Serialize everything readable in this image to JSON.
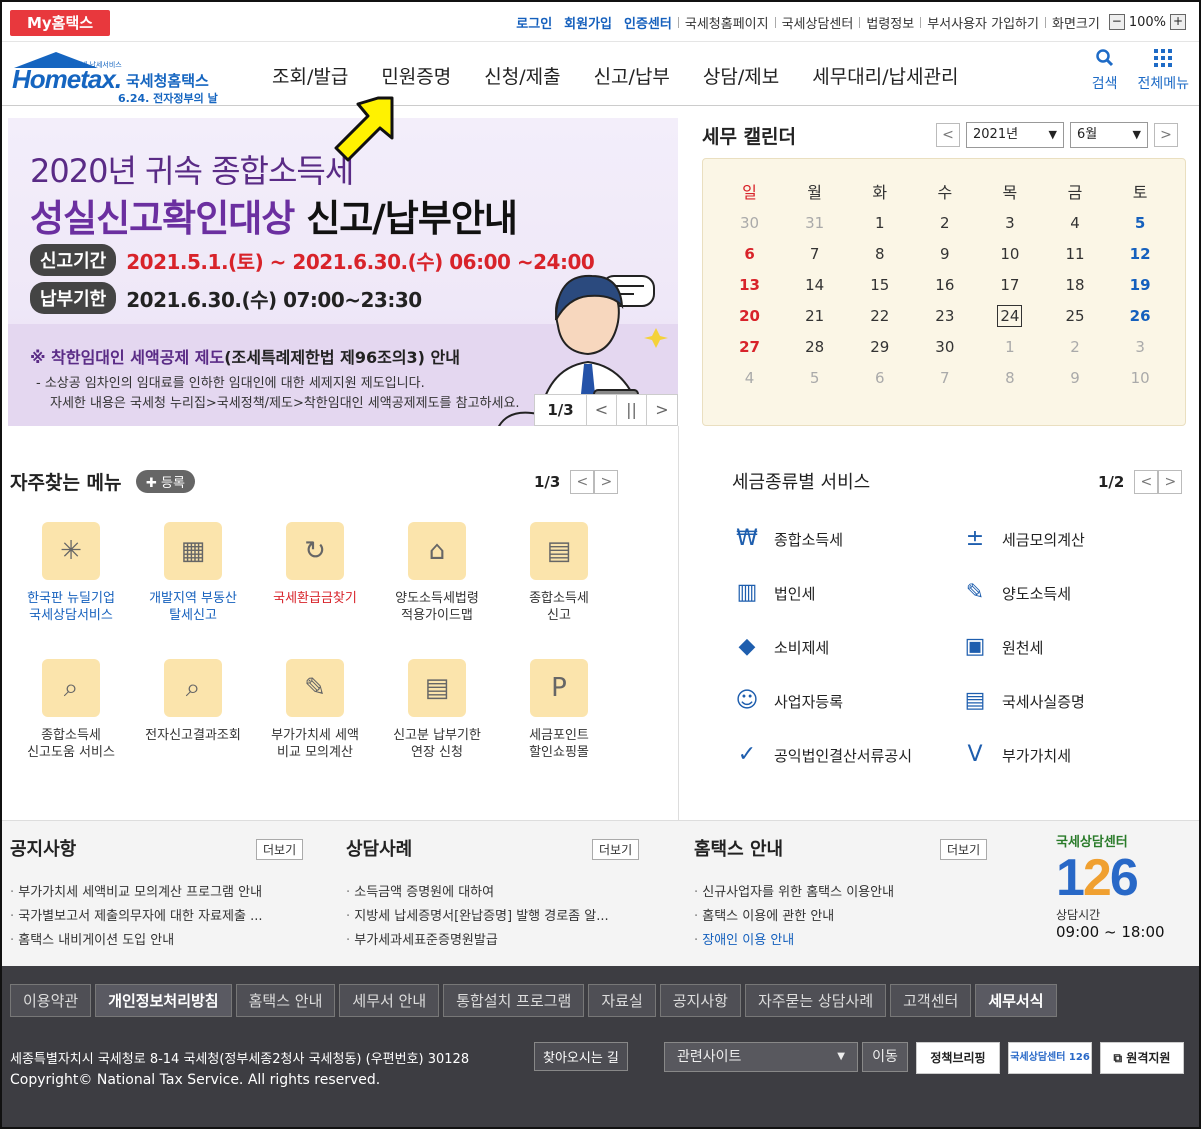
{
  "topbar": {
    "myhome": "My홈택스",
    "links_blue": [
      "로그인",
      "회원가입",
      "인증센터"
    ],
    "links": [
      "국세청홈페이지",
      "국세상담센터",
      "법령정보",
      "부서사용자 가입하기",
      "화면크기"
    ],
    "zoom_out": "−",
    "zoom_value": "100%",
    "zoom_in": "+"
  },
  "logo": {
    "hometax": "Hometax.",
    "name": "국세청홈택스",
    "tagline": "6.24. 전자정부의 날",
    "small": "언제넷 납세서비스"
  },
  "nav": {
    "items": [
      "조회/발급",
      "민원증명",
      "신청/제출",
      "신고/납부",
      "상담/제보",
      "세무대리/납세관리"
    ],
    "search_label": "검색",
    "all_menu_label": "전체메뉴",
    "search_icon": "search-icon",
    "grid_icon": "grid-icon"
  },
  "banner": {
    "title1": "2020년 귀속 종합소득세",
    "title2_em": "성실신고확인대상",
    "title2_rest": " 신고/납부안내",
    "period_label": "신고기간",
    "period_value": "2021.5.1.(토) ~ 2021.6.30.(수) 06:00 ~24:00",
    "pay_label": "납부기한",
    "pay_value": "2021.6.30.(수) 07:00~23:30",
    "note_title_em": "※ 착한임대인 세액공제 제도",
    "note_title_rest": "(조세특례제한법 제96조의3) 안내",
    "note_line1": "- 소상공 임차인의 임대료를 인하한 임대인에 대한 세제지원 제도입니다.",
    "note_line2": "자세한 내용은 국세청 누리집>국세정책/제도>착한임대인 세액공제제도를 참고하세요.",
    "page": "1/3",
    "prev": "<",
    "pause": "||",
    "next": ">"
  },
  "calendar": {
    "title": "세무 캘린더",
    "year": "2021년",
    "month": "6월",
    "prev": "<",
    "next": ">",
    "weekdays": [
      "일",
      "월",
      "화",
      "수",
      "목",
      "금",
      "토"
    ],
    "weeks": [
      [
        "30",
        "31",
        "1",
        "2",
        "3",
        "4",
        "5"
      ],
      [
        "6",
        "7",
        "8",
        "9",
        "10",
        "11",
        "12"
      ],
      [
        "13",
        "14",
        "15",
        "16",
        "17",
        "18",
        "19"
      ],
      [
        "20",
        "21",
        "22",
        "23",
        "24",
        "25",
        "26"
      ],
      [
        "27",
        "28",
        "29",
        "30",
        "1",
        "2",
        "3"
      ],
      [
        "4",
        "5",
        "6",
        "7",
        "8",
        "9",
        "10"
      ]
    ],
    "today": "24"
  },
  "frequent": {
    "title": "자주찾는 메뉴",
    "register": "✚ 등록",
    "page": "1/3",
    "items": [
      {
        "line1": "한국판 뉴딜기업",
        "line2": "국세상담서비스",
        "icon": "✳",
        "icon_name": "newdeal-icon",
        "tone": "blue"
      },
      {
        "line1": "개발지역 부동산",
        "line2": "탈세신고",
        "icon": "▦",
        "icon_name": "building-icon",
        "tone": "blue"
      },
      {
        "line1": "국세환급금찾기",
        "line2": "",
        "icon": "↻",
        "icon_name": "refund-icon",
        "tone": "red"
      },
      {
        "line1": "양도소득세법령",
        "line2": "적용가이드맵",
        "icon": "⌂",
        "icon_name": "house-icon",
        "tone": ""
      },
      {
        "line1": "종합소득세",
        "line2": "신고",
        "icon": "▤",
        "icon_name": "calendar-icon",
        "tone": ""
      },
      {
        "line1": "종합소득세",
        "line2": "신고도움 서비스",
        "icon": "⌕",
        "icon_name": "doc-search-icon",
        "tone": ""
      },
      {
        "line1": "전자신고결과조회",
        "line2": "",
        "icon": "⌕",
        "icon_name": "result-search-icon",
        "tone": ""
      },
      {
        "line1": "부가가치세 세액",
        "line2": "비교 모의계산",
        "icon": "✎",
        "icon_name": "edit-icon",
        "tone": ""
      },
      {
        "line1": "신고분 납부기한",
        "line2": "연장 신청",
        "icon": "▤",
        "icon_name": "calendar-check-icon",
        "tone": ""
      },
      {
        "line1": "세금포인트",
        "line2": "할인쇼핑몰",
        "icon": "P",
        "icon_name": "tax-point-icon",
        "tone": ""
      }
    ]
  },
  "taxservice": {
    "title": "세금종류별 서비스",
    "page": "1/2",
    "items": [
      {
        "label": "종합소득세",
        "icon": "₩",
        "icon_name": "money-bag-icon"
      },
      {
        "label": "세금모의계산",
        "icon": "±",
        "icon_name": "calculator-icon"
      },
      {
        "label": "법인세",
        "icon": "▥",
        "icon_name": "office-building-icon"
      },
      {
        "label": "양도소득세",
        "icon": "✎",
        "icon_name": "transfer-doc-icon"
      },
      {
        "label": "소비제세",
        "icon": "◆",
        "icon_name": "diamond-icon"
      },
      {
        "label": "원천세",
        "icon": "▣",
        "icon_name": "salary-doc-icon"
      },
      {
        "label": "사업자등록",
        "icon": "☺",
        "icon_name": "person-icon"
      },
      {
        "label": "국세사실증명",
        "icon": "▤",
        "icon_name": "certificate-icon"
      },
      {
        "label": "공익법인결산서류공시",
        "icon": "✓",
        "icon_name": "clipboard-check-icon"
      },
      {
        "label": "부가가치세",
        "icon": "V",
        "icon_name": "vat-icon"
      }
    ]
  },
  "news": {
    "more": "더보기",
    "notice": {
      "title": "공지사항",
      "items": [
        "부가가치세 세액비교 모의계산 프로그램 안내",
        "국가별보고서 제출의무자에 대한 자료제출 ...",
        "홈택스 내비게이션 도입 안내"
      ]
    },
    "cases": {
      "title": "상담사례",
      "items": [
        "소득금액 증명원에 대하여",
        "지방세 납세증명서[완납증명] 발행 경로좀 알...",
        "부가세과세표준증명원발급"
      ]
    },
    "guide": {
      "title": "홈택스 안내",
      "items": [
        "신규사업자를 위한 홈택스 이용안내",
        "홈택스 이용에 관한 안내",
        "장애인 이용 안내"
      ]
    },
    "center": {
      "label": "국세상담센터",
      "number_a": "1",
      "number_b": "2",
      "number_c": "6",
      "hours_label": "상담시간",
      "hours": "09:00 ~ 18:00"
    }
  },
  "footer": {
    "links": [
      "이용약관",
      "개인정보처리방침",
      "홈택스 안내",
      "세무서 안내",
      "통합설치 프로그램",
      "자료실",
      "공지사항",
      "자주묻는 상담사례",
      "고객센터",
      "세무서식"
    ],
    "address": "세종특별자치시 국세청로 8-14 국세청(정부세종2청사 국세청동) (우편번호) 30128",
    "find_way": "찾아오시는 길",
    "copyright": "Copyright© National Tax Service. All rights reserved.",
    "related": "관련사이트",
    "go": "이동",
    "btn1": "정책브리핑",
    "btn2": "국세상담센터 126",
    "btn3": "원격지원"
  }
}
